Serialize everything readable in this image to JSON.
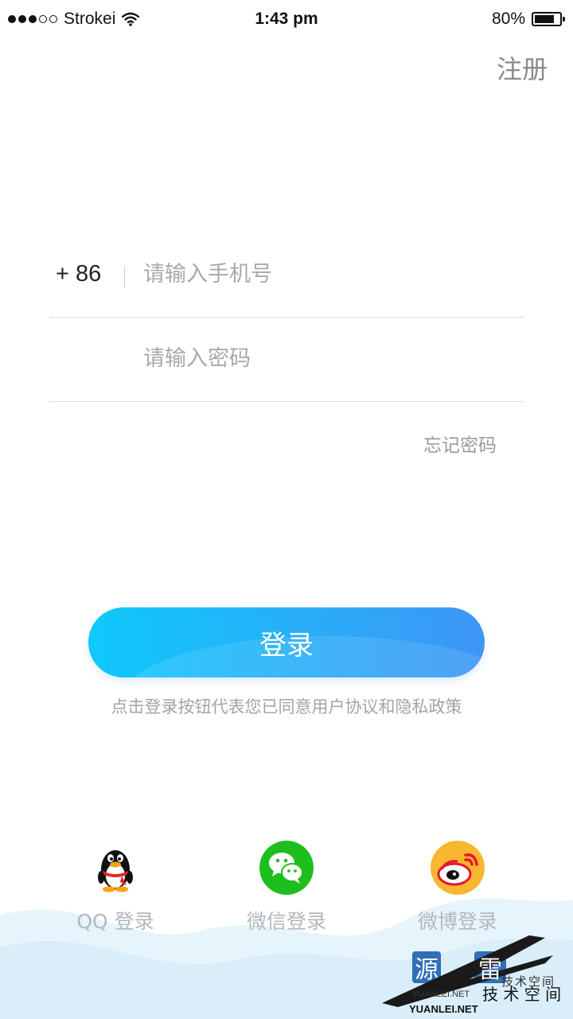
{
  "status_bar": {
    "carrier": "Strokei",
    "time": "1:43 pm",
    "battery_text": "80%",
    "battery_level": 0.8,
    "signal_bars_filled": 3,
    "signal_bars_total": 5
  },
  "header": {
    "register_label": "注册"
  },
  "form": {
    "country_code": "+ 86",
    "phone_placeholder": "请输入手机号",
    "phone_value": "",
    "password_placeholder": "请输入密码",
    "password_value": "",
    "forgot_label": "忘记密码"
  },
  "login": {
    "button_label": "登录",
    "agreement_text": "点击登录按钮代表您已同意用户协议和隐私政策"
  },
  "social": [
    {
      "icon": "qq-penguin-icon",
      "label": "QQ 登录"
    },
    {
      "icon": "wechat-icon",
      "label": "微信登录"
    },
    {
      "icon": "weibo-icon",
      "label": "微博登录"
    }
  ],
  "watermark": {
    "char1": "源",
    "char2": "雷",
    "small_text": "技术空间",
    "big_text": "技 术 空 间",
    "url_small": "YUANLEI.NET",
    "url": "YUANLEI.NET"
  },
  "colors": {
    "button_gradient_start": "#0fc9fb",
    "button_gradient_end": "#3e96f6",
    "wechat_green": "#1ebe1e",
    "weibo_orange": "#f7b731",
    "weibo_red": "#e6162d"
  }
}
